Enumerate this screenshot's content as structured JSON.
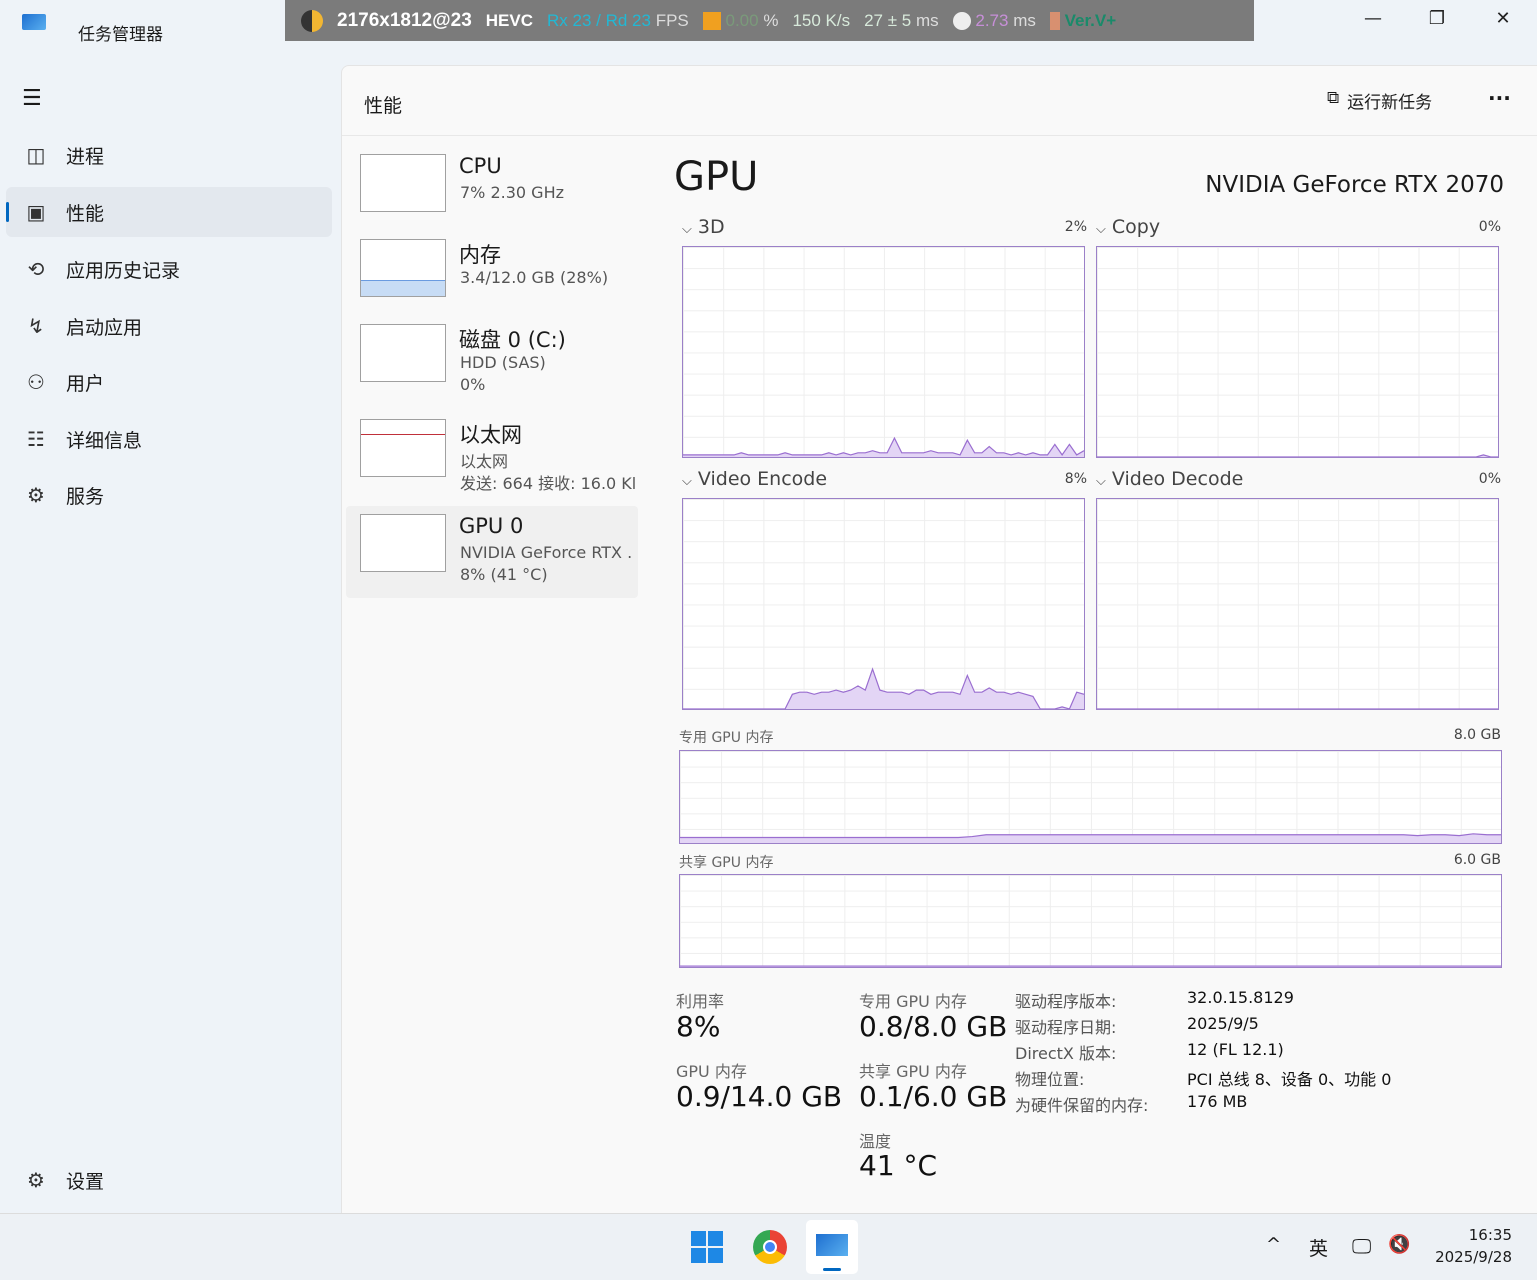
{
  "window": {
    "title": "任务管理器",
    "minimize": "—",
    "maximize": "❐",
    "close": "✕"
  },
  "overlay": {
    "resolution": "2176x1812@23",
    "codec": "HEVC",
    "fps": "Rx 23 / Rd 23",
    "fps_unit": "FPS",
    "loss": "0.00",
    "loss_unit": "%",
    "bitrate": "150 K/s",
    "latency": "27 ± 5",
    "latency_unit": "ms",
    "decode": "2.73",
    "decode_unit": "ms",
    "version": "Ver.V+",
    "colors": {
      "fps": "#22b8d4",
      "loss": "#7a9a7a",
      "decode": "#c78fd8",
      "version": "#1a8a6a"
    }
  },
  "sidebar": {
    "items": [
      {
        "label": "进程",
        "icon": "processes-icon"
      },
      {
        "label": "性能",
        "icon": "performance-icon"
      },
      {
        "label": "应用历史记录",
        "icon": "history-icon"
      },
      {
        "label": "启动应用",
        "icon": "startup-icon"
      },
      {
        "label": "用户",
        "icon": "users-icon"
      },
      {
        "label": "详细信息",
        "icon": "details-icon"
      },
      {
        "label": "服务",
        "icon": "services-icon"
      }
    ],
    "settings": "设置"
  },
  "header": {
    "title": "性能",
    "run_task": "运行新任务",
    "more": "···"
  },
  "devices": [
    {
      "name": "CPU",
      "line1": "7% 2.30 GHz",
      "line2": ""
    },
    {
      "name": "内存",
      "line1": "3.4/12.0 GB (28%)",
      "line2": ""
    },
    {
      "name": "磁盘 0 (C:)",
      "line1": "HDD (SAS)",
      "line2": "0%"
    },
    {
      "name": "以太网",
      "line1": "以太网",
      "line2": "发送: 664 接收: 16.0 Kl"
    },
    {
      "name": "GPU 0",
      "line1": "NVIDIA GeForce RTX .",
      "line2": "8% (41 °C)"
    }
  ],
  "gpu": {
    "title": "GPU",
    "model": "NVIDIA GeForce RTX 2070",
    "engines": [
      {
        "label": "3D",
        "pct": "2%",
        "history": [
          1,
          1,
          1,
          1,
          1,
          1,
          1,
          1,
          2,
          1,
          1,
          1,
          1,
          1,
          2,
          1,
          1,
          1,
          1,
          1,
          2,
          1,
          2,
          1,
          2,
          2,
          3,
          2,
          2,
          9,
          2,
          2,
          2,
          2,
          3,
          2,
          2,
          2,
          1,
          8,
          2,
          2,
          5,
          2,
          2,
          1,
          2,
          1,
          2,
          1,
          1,
          6,
          1,
          6,
          1,
          3
        ]
      },
      {
        "label": "Copy",
        "pct": "0%",
        "history": [
          0,
          0,
          0,
          0,
          0,
          0,
          0,
          0,
          0,
          0,
          0,
          0,
          0,
          0,
          0,
          0,
          0,
          0,
          0,
          0,
          0,
          0,
          0,
          0,
          0,
          0,
          0,
          0,
          0,
          0,
          0,
          0,
          0,
          0,
          0,
          0,
          0,
          0,
          0,
          0,
          0,
          0,
          0,
          0,
          0,
          0,
          0,
          0,
          0,
          0,
          0,
          0,
          0,
          1,
          0,
          0
        ]
      },
      {
        "label": "Video Encode",
        "pct": "8%",
        "history": [
          0,
          0,
          0,
          0,
          0,
          0,
          0,
          0,
          0,
          0,
          0,
          0,
          0,
          0,
          0,
          7,
          8,
          8,
          7,
          8,
          8,
          9,
          8,
          9,
          11,
          9,
          19,
          9,
          8,
          8,
          8,
          7,
          9,
          9,
          7,
          8,
          8,
          8,
          7,
          16,
          8,
          8,
          10,
          8,
          8,
          7,
          8,
          7,
          6,
          0,
          0,
          0,
          1,
          0,
          8,
          7
        ]
      },
      {
        "label": "Video Decode",
        "pct": "0%",
        "history": [
          0,
          0,
          0,
          0,
          0,
          0,
          0,
          0,
          0,
          0,
          0,
          0,
          0,
          0,
          0,
          0,
          0,
          0,
          0,
          0,
          0,
          0,
          0,
          0,
          0,
          0,
          0,
          0,
          0,
          0,
          0,
          0,
          0,
          0,
          0,
          0,
          0,
          0,
          0,
          0,
          0,
          0,
          0,
          0,
          0,
          0,
          0,
          0,
          0,
          0,
          0,
          0,
          0,
          0,
          0,
          0
        ]
      }
    ],
    "dedicated_label": "专用 GPU 内存",
    "dedicated_max": "8.0 GB",
    "dedicated_history": [
      6,
      6,
      6,
      6,
      6,
      6,
      6,
      6,
      6,
      6,
      6,
      6,
      6,
      6,
      6,
      6,
      6,
      6,
      6,
      6,
      6,
      7,
      9,
      9,
      9,
      9,
      9,
      9,
      9,
      9,
      9,
      9,
      9,
      9,
      9,
      9,
      9,
      9,
      9,
      9,
      9,
      9,
      9,
      9,
      9,
      9,
      9,
      9,
      9,
      9,
      9,
      9,
      9,
      8,
      9,
      9,
      8,
      10,
      9,
      9
    ],
    "shared_label": "共享 GPU 内存",
    "shared_max": "6.0 GB",
    "shared_history": [
      1,
      1,
      1,
      1,
      1,
      1,
      1,
      1,
      1,
      1,
      1,
      1,
      1,
      1,
      1,
      1,
      1,
      1,
      1,
      1,
      1,
      1,
      1,
      1,
      1,
      1,
      1,
      1,
      1,
      1,
      1,
      1,
      1,
      1,
      1,
      1,
      1,
      1,
      1,
      1,
      1,
      1,
      1,
      1,
      1,
      1,
      1,
      1,
      1,
      1,
      1,
      1,
      1,
      1,
      1,
      1,
      1,
      1,
      1,
      1
    ],
    "stats": {
      "util_label": "利用率",
      "util": "8%",
      "ded_label": "专用 GPU 内存",
      "ded": "0.8/8.0 GB",
      "mem_label": "GPU 内存",
      "mem": "0.9/14.0 GB",
      "shared_label": "共享 GPU 内存",
      "shared": "0.1/6.0 GB",
      "temp_label": "温度",
      "temp": "41 °C"
    },
    "info": [
      {
        "k": "驱动程序版本:",
        "v": "32.0.15.8129"
      },
      {
        "k": "驱动程序日期:",
        "v": "2025/9/5"
      },
      {
        "k": "DirectX 版本:",
        "v": "12 (FL 12.1)"
      },
      {
        "k": "物理位置:",
        "v": "PCI 总线 8、设备 0、功能 0"
      },
      {
        "k": "为硬件保留的内存:",
        "v": "176 MB"
      }
    ]
  },
  "taskbar": {
    "ime": "英",
    "time": "16:35",
    "date": "2025/9/28",
    "chevron": "^"
  }
}
